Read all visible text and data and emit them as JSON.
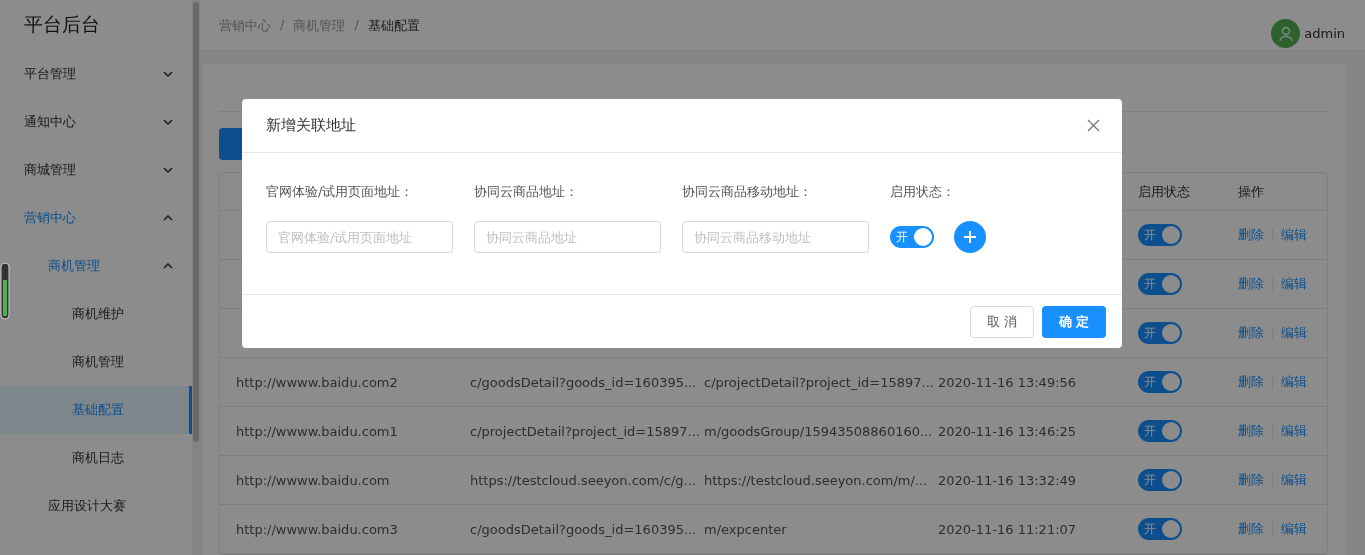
{
  "sidebar": {
    "title": "平台后台",
    "items": [
      {
        "label": "平台管理",
        "expanded": false
      },
      {
        "label": "通知中心",
        "expanded": false
      },
      {
        "label": "商城管理",
        "expanded": false
      },
      {
        "label": "营销中心",
        "expanded": true,
        "children": [
          {
            "label": "商机管理",
            "expanded": true,
            "children": [
              {
                "label": "商机维护",
                "selected": false
              },
              {
                "label": "商机管理",
                "selected": false
              },
              {
                "label": "基础配置",
                "selected": true
              },
              {
                "label": "商机日志",
                "selected": false
              }
            ]
          },
          {
            "label": "应用设计大赛",
            "selected": false
          }
        ]
      }
    ]
  },
  "breadcrumb": {
    "items": [
      "营销中心",
      "商机管理",
      "基础配置"
    ],
    "separators": [
      "/",
      "/"
    ]
  },
  "user": {
    "name": "admin"
  },
  "table": {
    "columns": [
      null,
      null,
      null,
      null,
      "启用状态",
      "操作"
    ],
    "rows": [
      {
        "cells": [
          null,
          null,
          null,
          null
        ],
        "enabled": true,
        "toggle_label": "开",
        "actions": [
          "删除",
          "编辑"
        ]
      },
      {
        "cells": [
          null,
          null,
          null,
          null
        ],
        "enabled": true,
        "toggle_label": "开",
        "actions": [
          "删除",
          "编辑"
        ]
      },
      {
        "cells": [
          null,
          null,
          null,
          null
        ],
        "enabled": true,
        "toggle_label": "开",
        "actions": [
          "删除",
          "编辑"
        ]
      },
      {
        "cells": [
          "http://wwww.baidu.com2",
          "c/goodsDetail?goods_id=160395...",
          "c/projectDetail?project_id=15897...",
          "2020-11-16 13:49:56"
        ],
        "enabled": true,
        "toggle_label": "开",
        "actions": [
          "删除",
          "编辑"
        ]
      },
      {
        "cells": [
          "http://wwww.baidu.com1",
          "c/projectDetail?project_id=15897...",
          "m/goodsGroup/15943508860160...",
          "2020-11-16 13:46:25"
        ],
        "enabled": true,
        "toggle_label": "开",
        "actions": [
          "删除",
          "编辑"
        ]
      },
      {
        "cells": [
          "http://wwww.baidu.com",
          "https://testcloud.seeyon.com/c/g...",
          "https://testcloud.seeyon.com/m/...",
          "2020-11-16 13:32:49"
        ],
        "enabled": true,
        "toggle_label": "开",
        "actions": [
          "删除",
          "编辑"
        ]
      },
      {
        "cells": [
          "http://wwww.baidu.com3",
          "c/goodsDetail?goods_id=160395...",
          "m/expcenter",
          "2020-11-16 11:21:07"
        ],
        "enabled": true,
        "toggle_label": "开",
        "actions": [
          "删除",
          "编辑"
        ]
      }
    ]
  },
  "modal": {
    "title": "新增关联地址",
    "fields": [
      {
        "label": "官网体验/试用页面地址：",
        "placeholder": "官网体验/试用页面地址"
      },
      {
        "label": "协同云商品地址：",
        "placeholder": "协同云商品地址"
      },
      {
        "label": "协同云商品移动地址：",
        "placeholder": "协同云商品移动地址"
      }
    ],
    "status": {
      "label": "启用状态：",
      "on": true,
      "toggle_label": "开"
    },
    "cancel": "取 消",
    "confirm": "确 定"
  }
}
